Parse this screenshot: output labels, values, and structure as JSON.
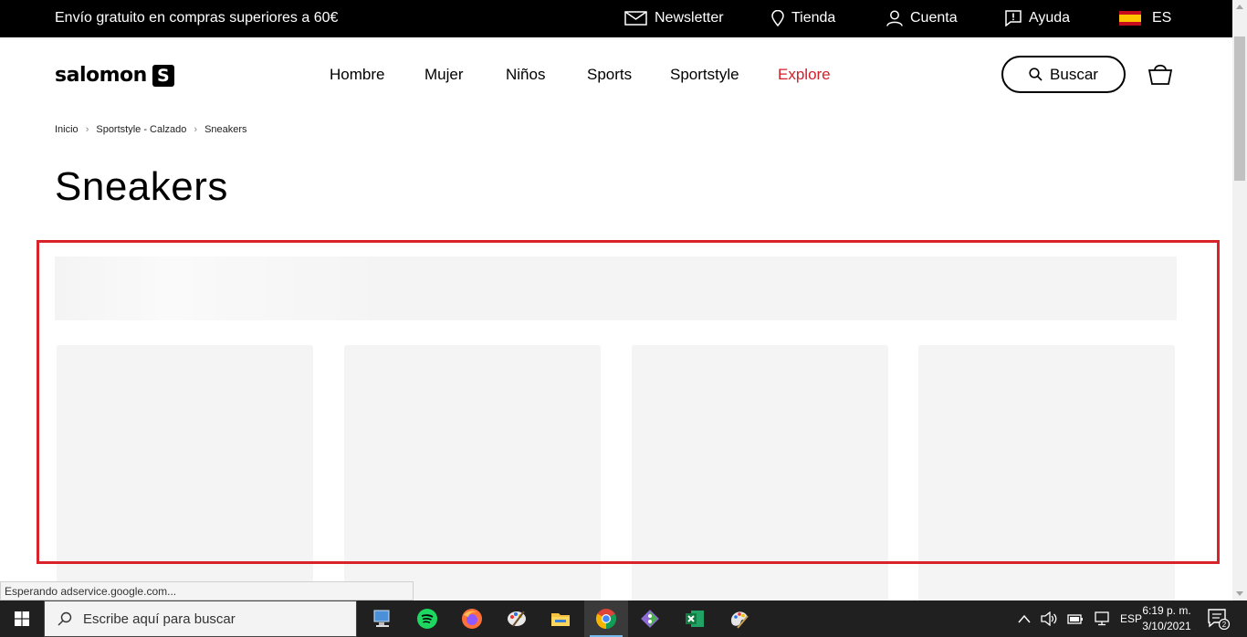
{
  "topbar": {
    "promo": "Envío gratuito en compras superiores a 60€",
    "tools": {
      "newsletter": "Newsletter",
      "store": "Tienda",
      "account": "Cuenta",
      "help": "Ayuda",
      "lang": "ES"
    }
  },
  "header": {
    "logo_text": "salomon",
    "logo_mark": "S",
    "nav": [
      "Hombre",
      "Mujer",
      "Niños",
      "Sports",
      "Sportstyle",
      "Explore"
    ],
    "search_label": "Buscar",
    "accent_color": "#d2202a"
  },
  "breadcrumb": [
    "Inicio",
    "Sportstyle - Calzado",
    "Sneakers"
  ],
  "page_title": "Sneakers",
  "status_text": "Esperando adservice.google.com...",
  "taskbar": {
    "search_placeholder": "Escribe aquí para buscar",
    "apps": [
      "network-computer-icon",
      "spotify-icon",
      "firefox-icon",
      "paint-icon",
      "file-explorer-icon",
      "chrome-icon",
      "git-icon",
      "excel-icon",
      "paint-3d-icon"
    ],
    "language": "ESP",
    "time": "6:19 p. m.",
    "date": "3/10/2021",
    "notifications": "2"
  }
}
